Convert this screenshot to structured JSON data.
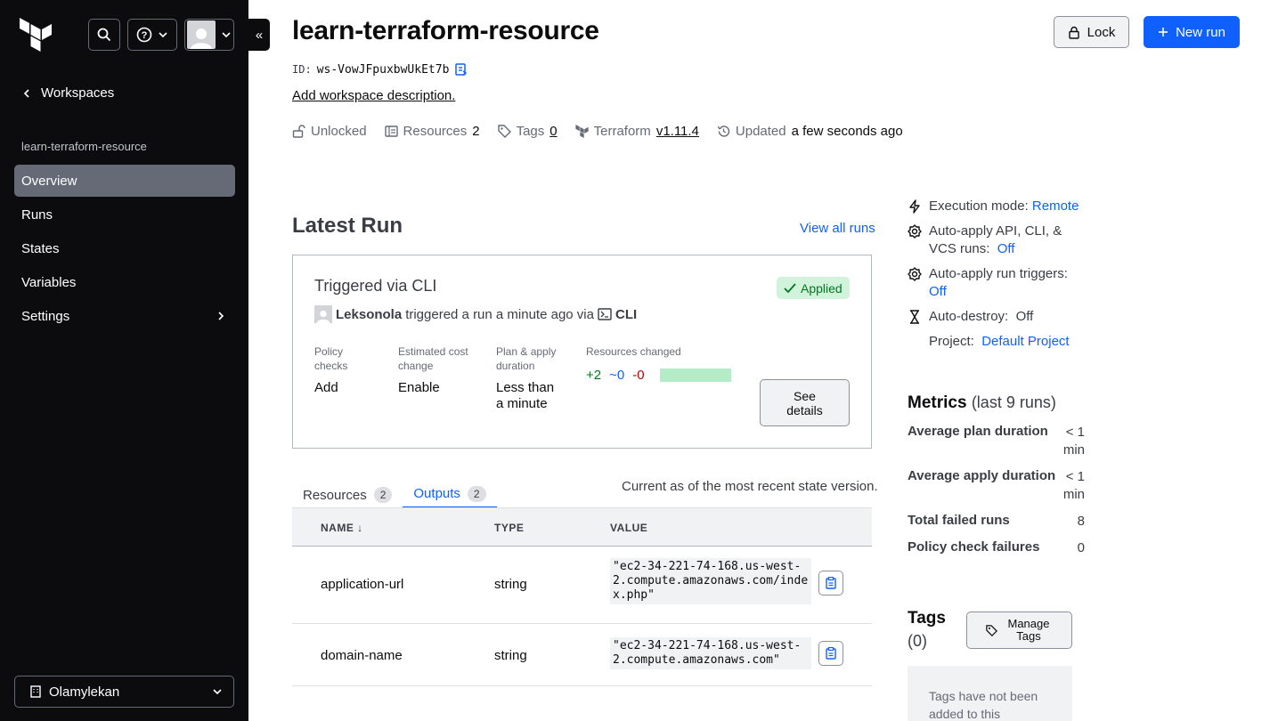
{
  "sidebar": {
    "back_label": "Workspaces",
    "workspace_name": "learn-terraform-resource",
    "nav": [
      {
        "label": "Overview"
      },
      {
        "label": "Runs"
      },
      {
        "label": "States"
      },
      {
        "label": "Variables"
      },
      {
        "label": "Settings"
      }
    ],
    "org_name": "Olamylekan"
  },
  "header": {
    "title": "learn-terraform-resource",
    "id_label": "ID:",
    "id_value": "ws-VowJFpuxbwUkEt7b",
    "description_link": "Add workspace description.",
    "lock_label": "Lock",
    "new_run_label": "New run",
    "meta": {
      "lock_status": "Unlocked",
      "resources_label": "Resources",
      "resources_count": "2",
      "tags_label": "Tags",
      "tags_count": "0",
      "terraform_label": "Terraform",
      "terraform_version": "v1.11.4",
      "updated_label": "Updated",
      "updated_value": "a few seconds ago"
    }
  },
  "latest_run": {
    "heading": "Latest Run",
    "view_all": "View all runs",
    "title": "Triggered via CLI",
    "status": "Applied",
    "user": "Leksonola",
    "trigger_text": "triggered a run a minute ago via",
    "source": "CLI",
    "policy_label": "Policy checks",
    "policy_value": "Add",
    "cost_label": "Estimated cost change",
    "cost_value": "Enable",
    "duration_label": "Plan & apply duration",
    "duration_value": "Less than a minute",
    "changes_label": "Resources changed",
    "added": "+2",
    "changed": "~0",
    "destroyed": "-0",
    "details_button": "See details"
  },
  "tabs": [
    {
      "label": "Resources",
      "count": "2"
    },
    {
      "label": "Outputs",
      "count": "2"
    }
  ],
  "current_as": "Current as of the most recent state version.",
  "outputs": {
    "columns": [
      "NAME ↓",
      "TYPE",
      "VALUE"
    ],
    "rows": [
      {
        "name": "application-url",
        "type": "string",
        "value": "\"ec2-34-221-74-168.us-west-2.compute.amazonaws.com/index.php\""
      },
      {
        "name": "domain-name",
        "type": "string",
        "value": "\"ec2-34-221-74-168.us-west-2.compute.amazonaws.com\""
      }
    ]
  },
  "settings_panel": {
    "execution_label": "Execution mode:",
    "execution_value": "Remote",
    "auto_apply_label": "Auto-apply API, CLI, & VCS runs:",
    "auto_apply_value": "Off",
    "auto_apply_triggers_label": "Auto-apply run triggers:",
    "auto_apply_triggers_value": "Off",
    "auto_destroy_label": "Auto-destroy:",
    "auto_destroy_value": "Off",
    "project_label": "Project:",
    "project_value": "Default Project"
  },
  "metrics": {
    "title": "Metrics",
    "subtitle": "(last 9 runs)",
    "items": [
      {
        "label": "Average plan duration",
        "value": "< 1 min"
      },
      {
        "label": "Average apply duration",
        "value": "< 1 min"
      },
      {
        "label": "Total failed runs",
        "value": "8"
      },
      {
        "label": "Policy check failures",
        "value": "0"
      }
    ]
  },
  "tags_panel": {
    "title": "Tags",
    "count": "(0)",
    "manage_button": "Manage Tags",
    "empty_text": "Tags have not been added to this"
  },
  "colors": {
    "sidebar_bg": "#0c0c0e",
    "accent": "#1060ff",
    "success": "#00781e",
    "danger": "#c00005"
  }
}
